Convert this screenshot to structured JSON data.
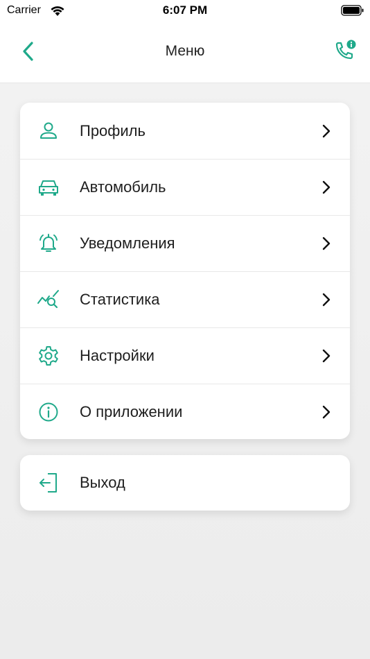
{
  "status_bar": {
    "carrier": "Carrier",
    "time": "6:07 PM"
  },
  "nav": {
    "title": "Меню",
    "back_icon": "chevron-left-icon",
    "call_icon": "phone-info-icon"
  },
  "colors": {
    "accent": "#1fa98a",
    "text": "#1e1e1e",
    "background": "#eeeeee"
  },
  "menu": {
    "items": [
      {
        "label": "Профиль",
        "icon": "user-icon"
      },
      {
        "label": "Автомобиль",
        "icon": "car-icon"
      },
      {
        "label": "Уведомления",
        "icon": "bell-icon"
      },
      {
        "label": "Статистика",
        "icon": "chart-search-icon"
      },
      {
        "label": "Настройки",
        "icon": "gear-icon"
      },
      {
        "label": "О приложении",
        "icon": "info-icon"
      }
    ]
  },
  "logout": {
    "label": "Выход",
    "icon": "logout-icon"
  }
}
